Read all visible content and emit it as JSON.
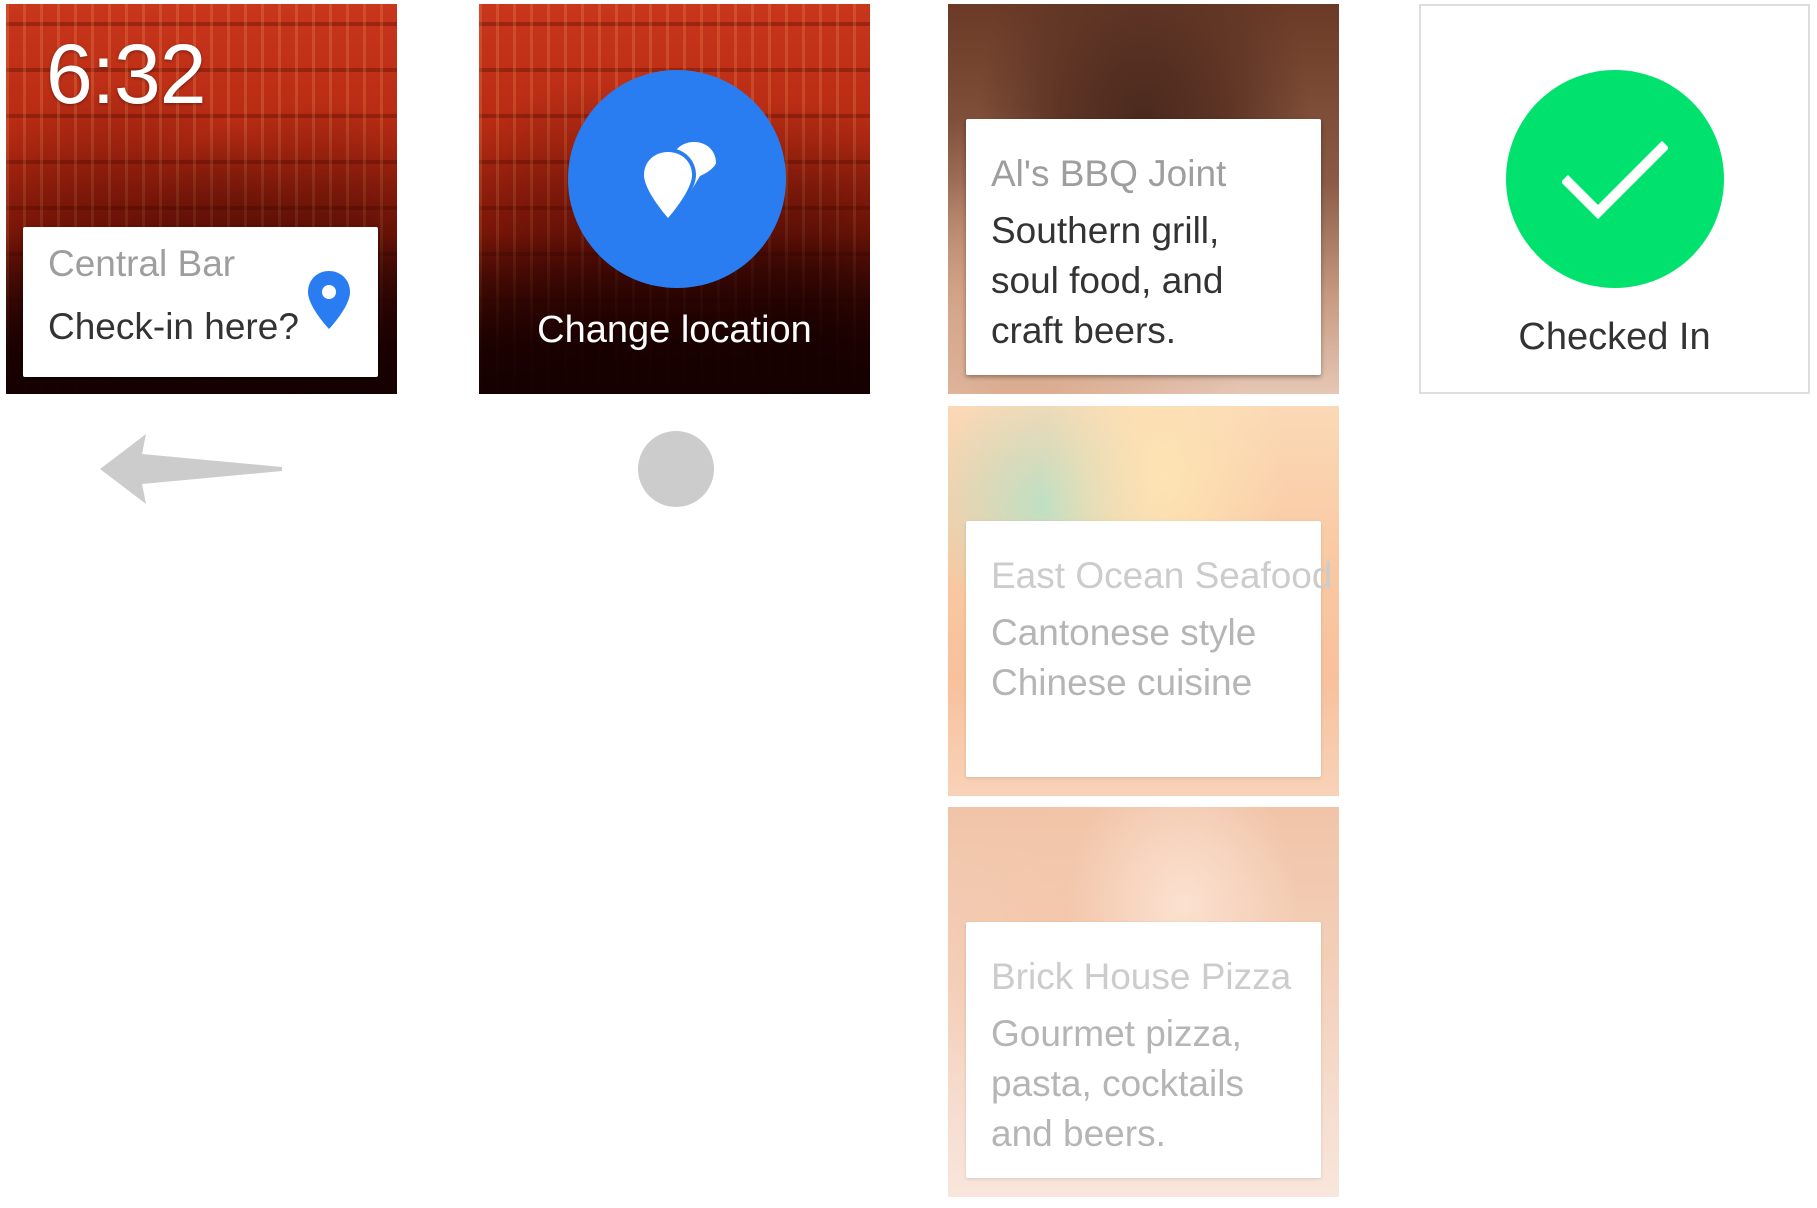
{
  "screen1": {
    "time": "6:32",
    "card_title": "Central Bar",
    "card_body": "Check-in here?",
    "pin_icon": "location-pin-icon",
    "accent_color": "#2a7df1"
  },
  "nav": {
    "swipe_icon": "swipe-left-arrow-icon",
    "tap_icon": "tap-dot-icon"
  },
  "screen2": {
    "action_label": "Change location",
    "action_icon": "change-location-icon",
    "circle_color": "#2a7df1"
  },
  "restaurants": [
    {
      "name": "Al's BBQ Joint",
      "line1": "Southern grill,",
      "line2": "soul food, and",
      "line3": "craft beers."
    },
    {
      "name": "East Ocean Seafood",
      "line1": "Cantonese style",
      "line2": "Chinese cuisine",
      "line3": ""
    },
    {
      "name": "Brick House Pizza",
      "line1": "Gourmet pizza,",
      "line2": "pasta, cocktails",
      "line3": "and beers."
    }
  ],
  "screen4": {
    "status_label": "Checked In",
    "check_icon": "checkmark-icon",
    "circle_color": "#00e26d"
  }
}
